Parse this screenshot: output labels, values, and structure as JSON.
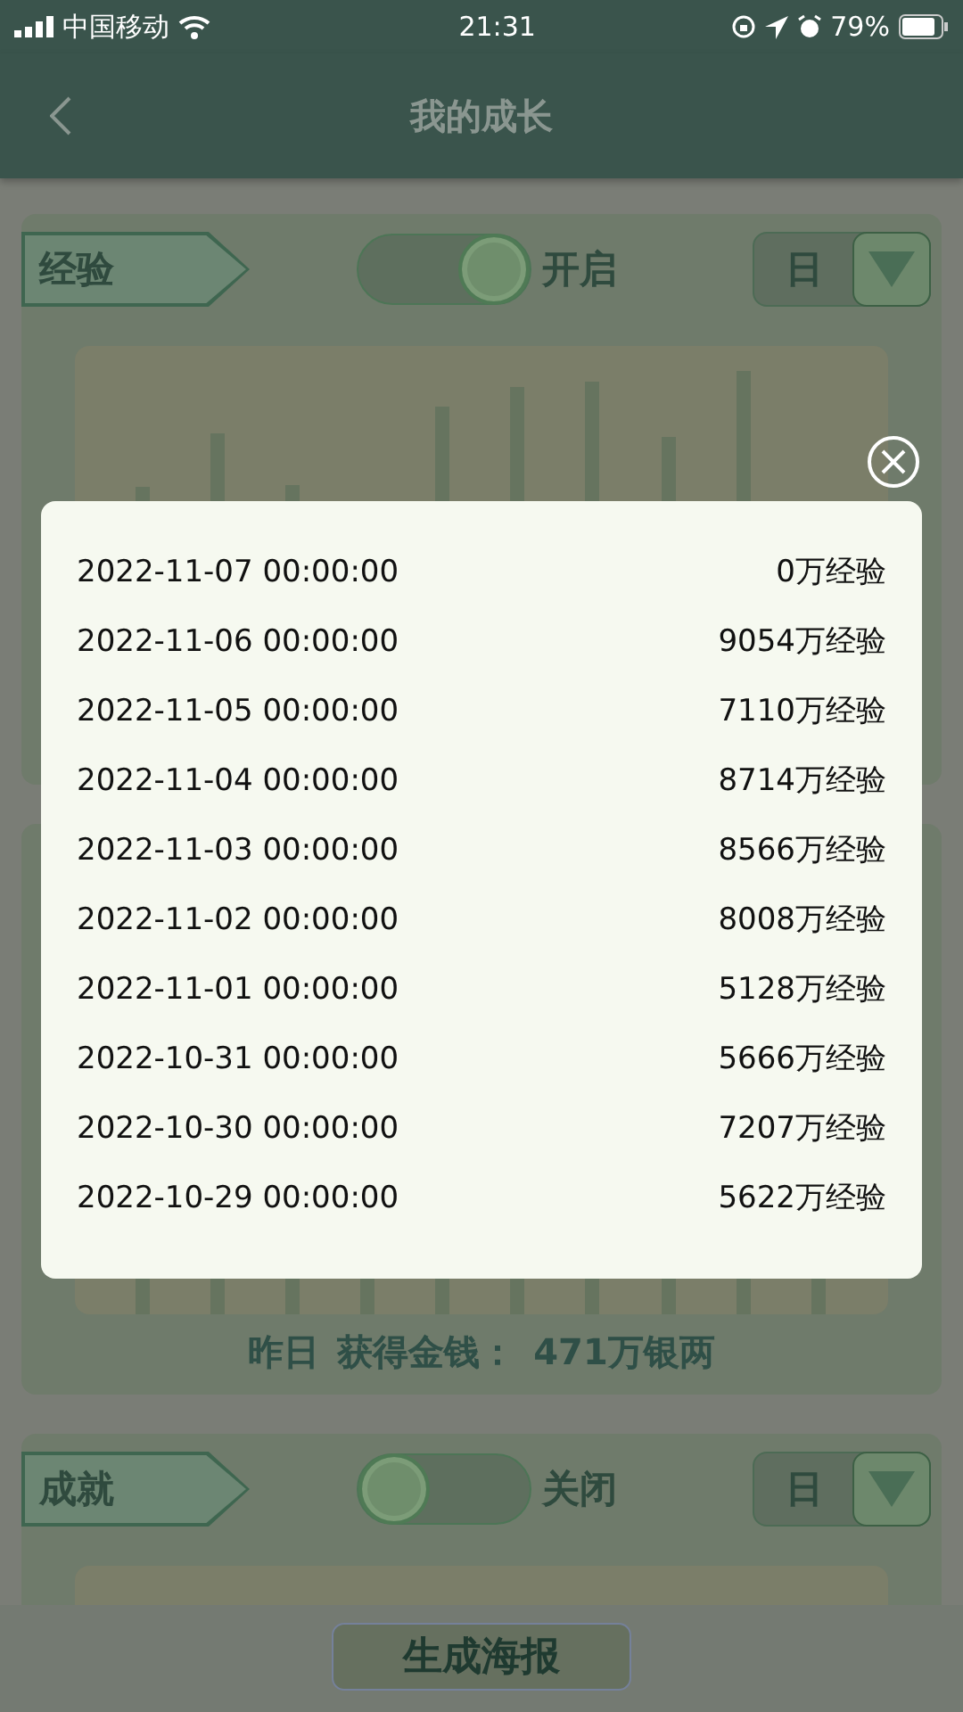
{
  "status_bar": {
    "carrier": "中国移动",
    "time": "21:31",
    "battery": "79%"
  },
  "nav": {
    "title": "我的成长"
  },
  "sections": [
    {
      "label": "经验",
      "toggle": {
        "on": true,
        "label": "开启"
      },
      "period": "日"
    },
    {
      "summary": {
        "day": "昨日",
        "caption": "获得金钱：",
        "amount": "471万银两"
      }
    },
    {
      "label": "成就",
      "toggle": {
        "on": false,
        "label": "关闭"
      },
      "period": "日"
    }
  ],
  "poster_button": "生成海报",
  "dialog": {
    "rows": [
      {
        "date": "2022-11-07 00:00:00",
        "value": "0万经验"
      },
      {
        "date": "2022-11-06 00:00:00",
        "value": "9054万经验"
      },
      {
        "date": "2022-11-05 00:00:00",
        "value": "7110万经验"
      },
      {
        "date": "2022-11-04 00:00:00",
        "value": "8714万经验"
      },
      {
        "date": "2022-11-03 00:00:00",
        "value": "8566万经验"
      },
      {
        "date": "2022-11-02 00:00:00",
        "value": "8008万经验"
      },
      {
        "date": "2022-11-01 00:00:00",
        "value": "5128万经验"
      },
      {
        "date": "2022-10-31 00:00:00",
        "value": "5666万经验"
      },
      {
        "date": "2022-10-30 00:00:00",
        "value": "7207万经验"
      },
      {
        "date": "2022-10-29 00:00:00",
        "value": "5622万经验"
      }
    ]
  }
}
